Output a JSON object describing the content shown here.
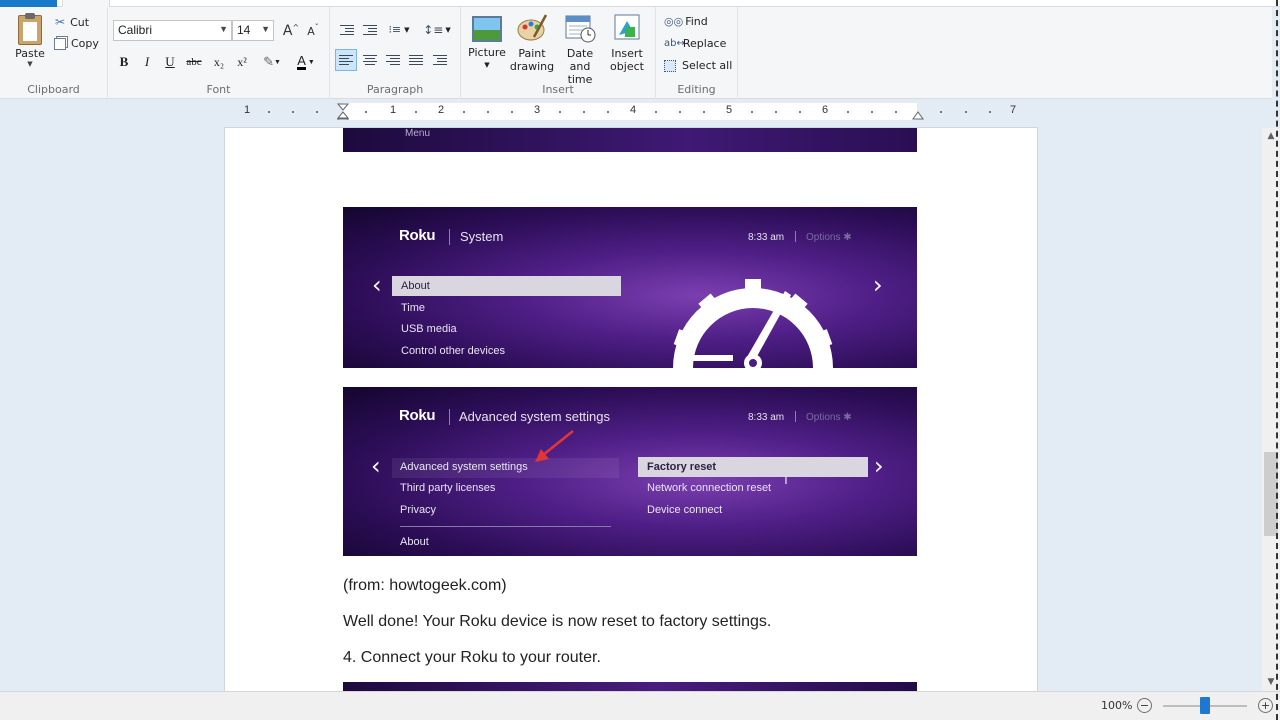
{
  "ribbon": {
    "clipboard": {
      "paste": "Paste",
      "cut": "Cut",
      "copy": "Copy",
      "label": "Clipboard"
    },
    "font": {
      "family": "Calibri",
      "size": "14",
      "label": "Font",
      "grow_glyph": "A",
      "shrink_glyph": "A",
      "bold": "B",
      "italic": "I",
      "underline": "U",
      "strike": "abc",
      "subscript": "x₂",
      "superscript": "x²",
      "color_glyph": "A"
    },
    "paragraph": {
      "label": "Paragraph"
    },
    "insert": {
      "label": "Insert",
      "picture": "Picture",
      "paint_1": "Paint",
      "paint_2": "drawing",
      "date_1": "Date and",
      "date_2": "time",
      "object_1": "Insert",
      "object_2": "object"
    },
    "editing": {
      "label": "Editing",
      "find": "Find",
      "replace": "Replace",
      "select_all": "Select all"
    }
  },
  "ruler": {
    "numbers": [
      "1",
      "1",
      "2",
      "3",
      "4",
      "5",
      "6",
      "7"
    ]
  },
  "document": {
    "roku_partial_top": "Menu",
    "roku_system": {
      "logo": "Roku",
      "heading": "System",
      "time": "8:33 am",
      "options": "Options ✱",
      "items": [
        "About",
        "Time",
        "USB media",
        "Control other devices"
      ]
    },
    "roku_advanced": {
      "logo": "Roku",
      "heading": "Advanced system settings",
      "time": "8:33 am",
      "options": "Options ✱",
      "left_items": [
        "Advanced system settings",
        "Third party licenses",
        "Privacy",
        "About"
      ],
      "right_items": [
        "Factory reset",
        "Network connection reset",
        "Device connect"
      ]
    },
    "caption": "(from: howtogeek.com)",
    "line1": "Well done! Your Roku device is now reset to factory settings.",
    "line2": "4. Connect your Roku to your router."
  },
  "status": {
    "zoom": "100%",
    "zoom_out": "−",
    "zoom_in": "+",
    "zoom_fraction": 0.5
  }
}
